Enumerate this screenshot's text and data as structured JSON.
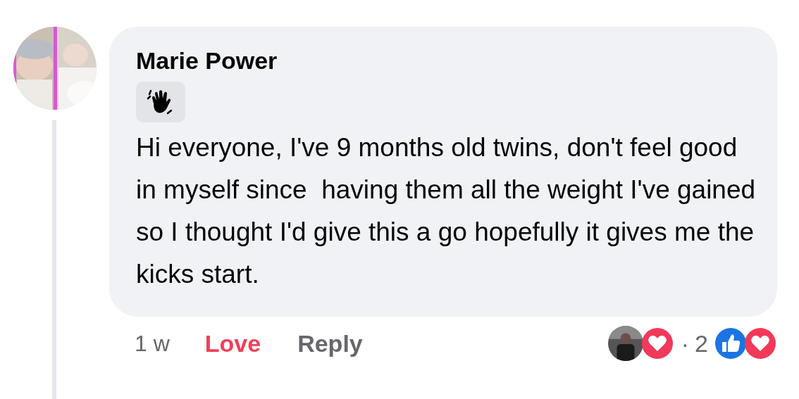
{
  "comment": {
    "author": "Marie Power",
    "badge": {
      "kind": "wave"
    },
    "text": "Hi everyone, I've 9 months old twins, don't feel good in myself since  having them all the weight I've gained so I thought I'd give this a go hopefully it gives me the kicks start."
  },
  "footer": {
    "time": "1 w",
    "actions": [
      {
        "label": "Love",
        "selected": true
      },
      {
        "label": "Reply",
        "selected": false
      }
    ]
  },
  "reply_summary": {
    "separator": "·",
    "count": "2",
    "reactions": [
      {
        "kind": "like"
      },
      {
        "kind": "love"
      }
    ]
  }
}
